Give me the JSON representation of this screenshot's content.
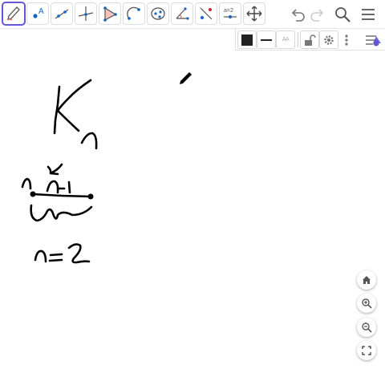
{
  "toolbar": {
    "tools": [
      {
        "name": "pen-tool",
        "icon": "pen-icon",
        "active": true
      },
      {
        "name": "point-tool",
        "icon": "point-icon",
        "label": "A"
      },
      {
        "name": "line-tool",
        "icon": "line-icon"
      },
      {
        "name": "perpendicular-line-tool",
        "icon": "perpendicular-line-icon"
      },
      {
        "name": "polygon-tool",
        "icon": "polygon-icon"
      },
      {
        "name": "circle-arc-tool",
        "icon": "circle-arc-icon"
      },
      {
        "name": "ellipse-tool",
        "icon": "ellipse-icon"
      },
      {
        "name": "angle-tool",
        "icon": "angle-icon"
      },
      {
        "name": "reflect-tool",
        "icon": "reflect-icon"
      },
      {
        "name": "slider-tool",
        "icon": "slider-icon",
        "label": "a=2"
      },
      {
        "name": "move-graphics-tool",
        "icon": "move-icon"
      }
    ],
    "right": [
      "undo-icon",
      "redo-icon",
      "search-icon",
      "menu-icon"
    ]
  },
  "stylebar": {
    "items": [
      "color-swatch",
      "line-style",
      "label-style",
      "lock",
      "settings",
      "more"
    ],
    "label_style_text": "AA",
    "color": "#222222"
  },
  "canvas": {
    "strokes_color": "#000000",
    "pen_cursor": "pencil-icon"
  },
  "zoom": [
    "home-icon",
    "zoom-in-icon",
    "zoom-out-icon",
    "fullscreen-icon"
  ],
  "colors": {
    "accent": "#6557d2",
    "point_blue": "#1565c0",
    "icon_gray": "#555555"
  }
}
